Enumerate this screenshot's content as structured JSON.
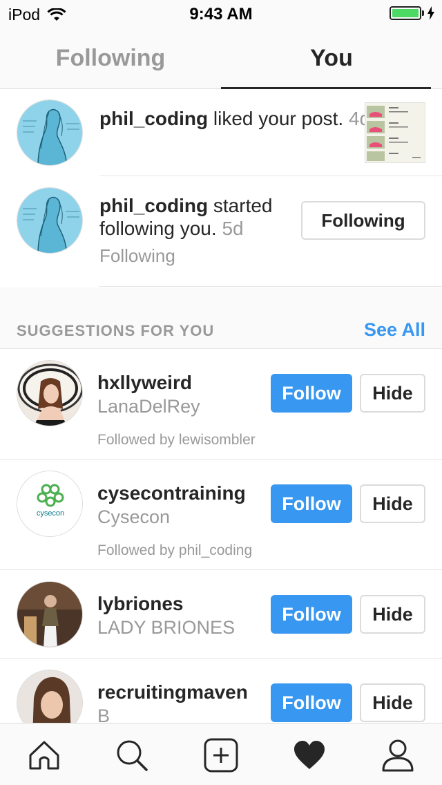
{
  "status_bar": {
    "device": "iPod",
    "time": "9:43 AM",
    "battery_level": 1.0,
    "battery_color": "#4cd964"
  },
  "tabs": [
    {
      "label": "Following",
      "active": false
    },
    {
      "label": "You",
      "active": true
    }
  ],
  "activity": [
    {
      "username": "phil_coding",
      "action": " liked your post.",
      "ago": "4d",
      "avatar_icon": "sketch-portrait"
    },
    {
      "username": "phil_coding",
      "action": " started following you.",
      "ago": "5d",
      "sub_label": "Following",
      "button_label": "Following",
      "avatar_icon": "sketch-portrait"
    }
  ],
  "suggestions": {
    "title": "SUGGESTIONS FOR YOU",
    "see_all": "See All",
    "follow_label": "Follow",
    "hide_label": "Hide",
    "items": [
      {
        "username": "hxllyweird",
        "name": "LanaDelRey",
        "followed_by": "Followed by lewisombler"
      },
      {
        "username": "cysecontraining",
        "name": "Cysecon",
        "followed_by": "Followed by phil_coding",
        "logo_text": "cysecon"
      },
      {
        "username": "lybriones",
        "name": "LADY BRIONES"
      },
      {
        "username": "recruitingmaven",
        "name": "B"
      }
    ]
  },
  "bottom_nav": [
    {
      "icon": "home-icon"
    },
    {
      "icon": "search-icon"
    },
    {
      "icon": "add-post-icon"
    },
    {
      "icon": "heart-icon",
      "active": true
    },
    {
      "icon": "profile-icon"
    }
  ],
  "colors": {
    "accent": "#3897f0",
    "muted": "#999999",
    "text": "#262626"
  }
}
